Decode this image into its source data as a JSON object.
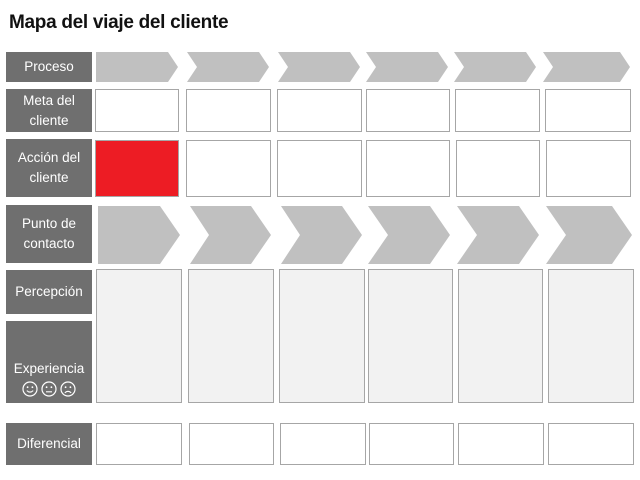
{
  "title": "Mapa del viaje del cliente",
  "rows": {
    "proceso": "Proceso",
    "meta": "Meta del cliente",
    "accion": "Acción del cliente",
    "punto": "Punto de contacto",
    "percepcion": "Percepción",
    "experiencia": "Experiencia",
    "diferencial": "Diferencial"
  },
  "icons": [
    "smiling-face-icon",
    "neutral-face-icon",
    "sad-face-icon"
  ],
  "colors": {
    "label_bg": "#6f6f6f",
    "chevron": "#c0c0c0",
    "highlight": "#ed1c24",
    "cell_grey": "#f2f2f2"
  }
}
